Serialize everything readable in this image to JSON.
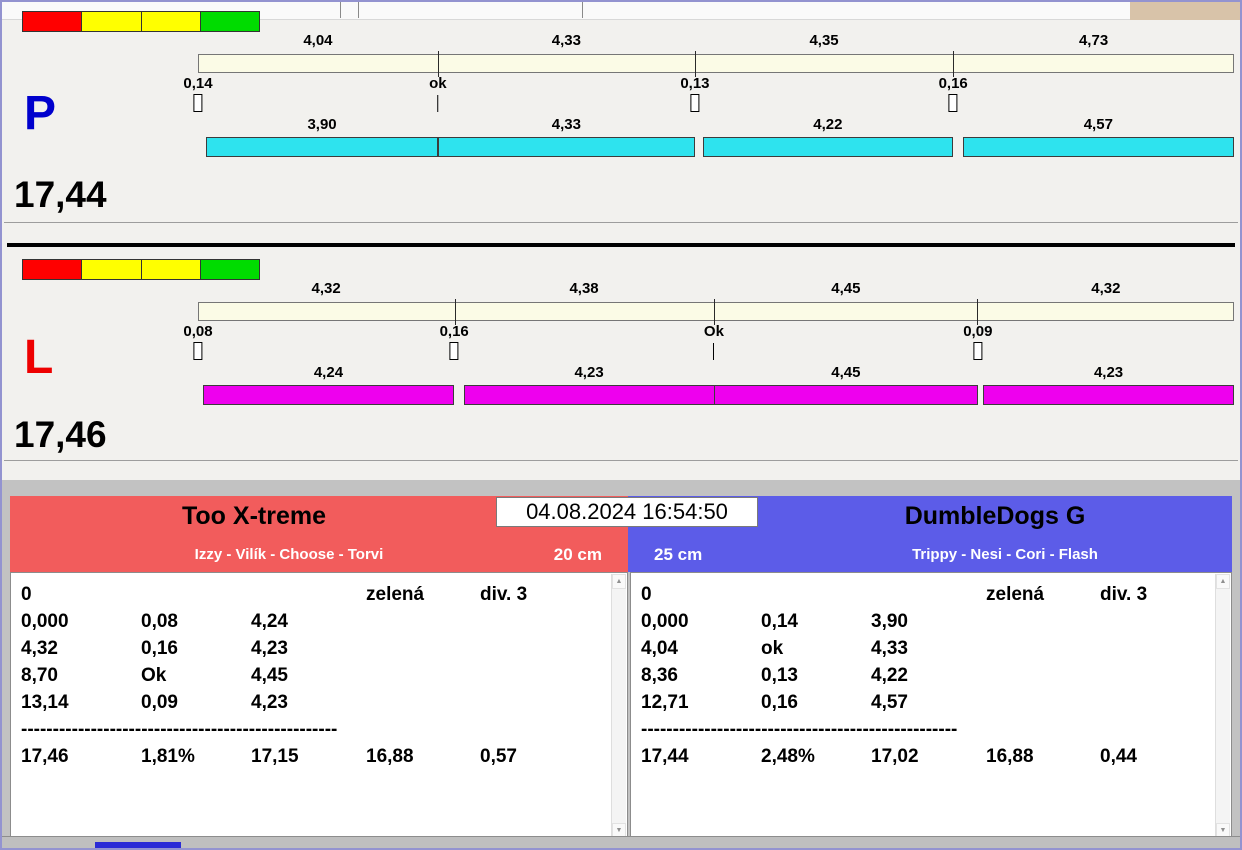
{
  "datetime": "04.08.2024 16:54:50",
  "traffic_light": [
    "#ff0000",
    "#ffff00",
    "#ffff00",
    "#00dc00"
  ],
  "panels": [
    {
      "letter": "P",
      "letter_color": "#0000cd",
      "total": "17,44",
      "bar_color": "#2ee3ee",
      "legs": [
        "4,04",
        "4,33",
        "4,35",
        "4,73"
      ],
      "changeovers": [
        "0,14",
        "ok",
        "0,13",
        "0,16"
      ],
      "dogs": [
        "3,90",
        "4,33",
        "4,22",
        "4,57"
      ]
    },
    {
      "letter": "L",
      "letter_color": "#ee0000",
      "total": "17,46",
      "bar_color": "#ee00ee",
      "legs": [
        "4,32",
        "4,38",
        "4,45",
        "4,32"
      ],
      "changeovers": [
        "0,08",
        "0,16",
        "Ok",
        "0,09"
      ],
      "dogs": [
        "4,24",
        "4,23",
        "4,45",
        "4,23"
      ]
    }
  ],
  "teams": [
    {
      "name": "Too X-treme",
      "dogs_line": "Izzy - Vilík - Choose - Torvi",
      "height": "20 cm",
      "header_color": "#f25c5c",
      "rows": [
        [
          "0",
          "",
          "",
          "zelená",
          "div. 3"
        ],
        [
          "0,000",
          "0,08",
          "4,24",
          "",
          ""
        ],
        [
          "4,32",
          "0,16",
          "4,23",
          "",
          ""
        ],
        [
          "8,70",
          "Ok",
          "4,45",
          "",
          ""
        ],
        [
          "13,14",
          "0,09",
          "4,23",
          "",
          ""
        ]
      ],
      "dashes": "--------------------------------------------------",
      "summary": [
        "17,46",
        "1,81%",
        "17,15",
        "16,88",
        "0,57"
      ]
    },
    {
      "name": "DumbleDogs G",
      "dogs_line": "Trippy - Nesi - Cori - Flash",
      "height": "25 cm",
      "header_color": "#5c5ce8",
      "rows": [
        [
          "0",
          "",
          "",
          "zelená",
          "div. 3"
        ],
        [
          "0,000",
          "0,14",
          "3,90",
          "",
          ""
        ],
        [
          "4,04",
          "ok",
          "4,33",
          "",
          ""
        ],
        [
          "8,36",
          "0,13",
          "4,22",
          "",
          ""
        ],
        [
          "12,71",
          "0,16",
          "4,57",
          "",
          ""
        ]
      ],
      "dashes": "--------------------------------------------------",
      "summary": [
        "17,44",
        "2,48%",
        "17,02",
        "16,88",
        "0,44"
      ]
    }
  ],
  "scrollbar": {
    "up_glyph": "▲",
    "down_glyph": "▼"
  }
}
